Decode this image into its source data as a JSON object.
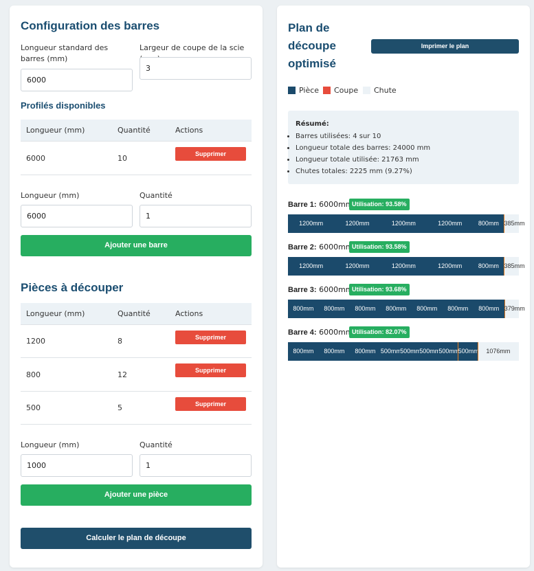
{
  "config": {
    "title": "Configuration des barres",
    "std_length_label": "Longueur standard des barres (mm)",
    "std_length_value": "6000",
    "kerf_label": "Largeur de coupe de la scie (mm)",
    "kerf_value": "3",
    "profiles_title": "Profilés disponibles",
    "headers": [
      "Longueur (mm)",
      "Quantité",
      "Actions"
    ],
    "profiles": [
      {
        "length": "6000",
        "qty": "10",
        "action": "Supprimer"
      }
    ],
    "new_length_label": "Longueur (mm)",
    "new_length_value": "6000",
    "new_qty_label": "Quantité",
    "new_qty_value": "1",
    "add_bar_button": "Ajouter une barre"
  },
  "pieces": {
    "title": "Pièces à découper",
    "headers": [
      "Longueur (mm)",
      "Quantité",
      "Actions"
    ],
    "rows": [
      {
        "length": "1200",
        "qty": "8",
        "action": "Supprimer"
      },
      {
        "length": "800",
        "qty": "12",
        "action": "Supprimer"
      },
      {
        "length": "500",
        "qty": "5",
        "action": "Supprimer"
      }
    ],
    "new_length_label": "Longueur (mm)",
    "new_length_value": "1000",
    "new_qty_label": "Quantité",
    "new_qty_value": "1",
    "add_piece_button": "Ajouter une pièce",
    "calc_button": "Calculer le plan de découpe"
  },
  "plan": {
    "title_lines": [
      "Plan de",
      "découpe",
      "optimisé"
    ],
    "print_button": "Imprimer le plan",
    "legend": [
      {
        "label": "Pièce",
        "color": "#1b4a6b"
      },
      {
        "label": "Coupe",
        "color": "#e74c3c"
      },
      {
        "label": "Chute",
        "color": "#ecf2f6"
      }
    ],
    "summary": {
      "title": "Résumé:",
      "items": [
        "Barres utilisées: 4 sur 10",
        "Longueur totale des barres: 24000 mm",
        "Longueur totale utilisée: 21763 mm",
        "Chutes totales: 2225 mm (9.27%)"
      ]
    },
    "bars": [
      {
        "name": "Barre 1:",
        "length": "6000mm",
        "utilisation": "Utilisation: 93.58%",
        "total": 6000,
        "pieces": [
          1200,
          1200,
          1200,
          1200,
          800
        ],
        "piece_labels": [
          "1200mm",
          "1200mm",
          "1200mm",
          "1200mm",
          "800mm"
        ],
        "waste_label": "385mm"
      },
      {
        "name": "Barre 2:",
        "length": "6000mm",
        "utilisation": "Utilisation: 93.58%",
        "total": 6000,
        "pieces": [
          1200,
          1200,
          1200,
          1200,
          800
        ],
        "piece_labels": [
          "1200mm",
          "1200mm",
          "1200mm",
          "1200mm",
          "800mm"
        ],
        "waste_label": "385mm"
      },
      {
        "name": "Barre 3:",
        "length": "6000mm",
        "utilisation": "Utilisation: 93.68%",
        "total": 6000,
        "pieces": [
          800,
          800,
          800,
          800,
          800,
          800,
          800
        ],
        "piece_labels": [
          "800mm",
          "800mm",
          "800mm",
          "800mm",
          "800mm",
          "800mm",
          "800mm"
        ],
        "waste_label": "379mm"
      },
      {
        "name": "Barre 4:",
        "length": "6000mm",
        "utilisation": "Utilisation: 82.07%",
        "total": 6000,
        "pieces": [
          800,
          800,
          800,
          500,
          500,
          500,
          500,
          500
        ],
        "piece_labels": [
          "800mm",
          "800mm",
          "800mm",
          "500mm",
          "500mm",
          "500mm",
          "500mm",
          "500mm"
        ],
        "waste_label": "1076mm"
      }
    ]
  }
}
